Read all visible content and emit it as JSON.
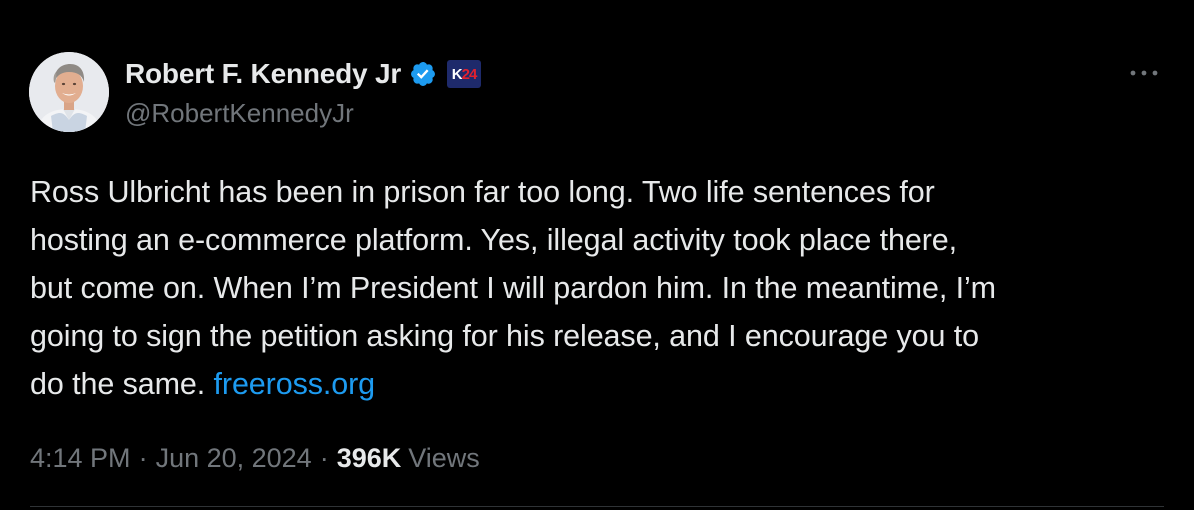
{
  "author": {
    "display_name": "Robert F. Kennedy Jr",
    "handle": "@RobertKennedyJr",
    "verified_icon": "verified-badge-icon",
    "verified_color": "#1d9bf0",
    "badge": {
      "letter": "K",
      "number": "24",
      "background": "#1e2a6b",
      "number_color": "#e0212f"
    }
  },
  "menu": {
    "icon": "more-horizontal-icon",
    "label": "···"
  },
  "tweet": {
    "lines": [
      "Ross Ulbricht has been in prison far too long. Two life sentences for",
      "hosting an e-commerce platform. Yes, illegal activity took place there,",
      "but come on. When I’m President I will pardon him. In the meantime, I’m",
      "going to sign the petition asking for his release, and I encourage you to"
    ],
    "last_line_text": "do the same. ",
    "link_text": "freeross.org",
    "link_color": "#1d9bf0"
  },
  "meta": {
    "time": "4:14 PM",
    "separator": "·",
    "date": "Jun 20, 2024",
    "views_count": "396K",
    "views_label": "Views"
  },
  "colors": {
    "background": "#000000",
    "primary_text": "#e7e9ea",
    "secondary_text": "#71767b",
    "divider": "#2f3336"
  }
}
